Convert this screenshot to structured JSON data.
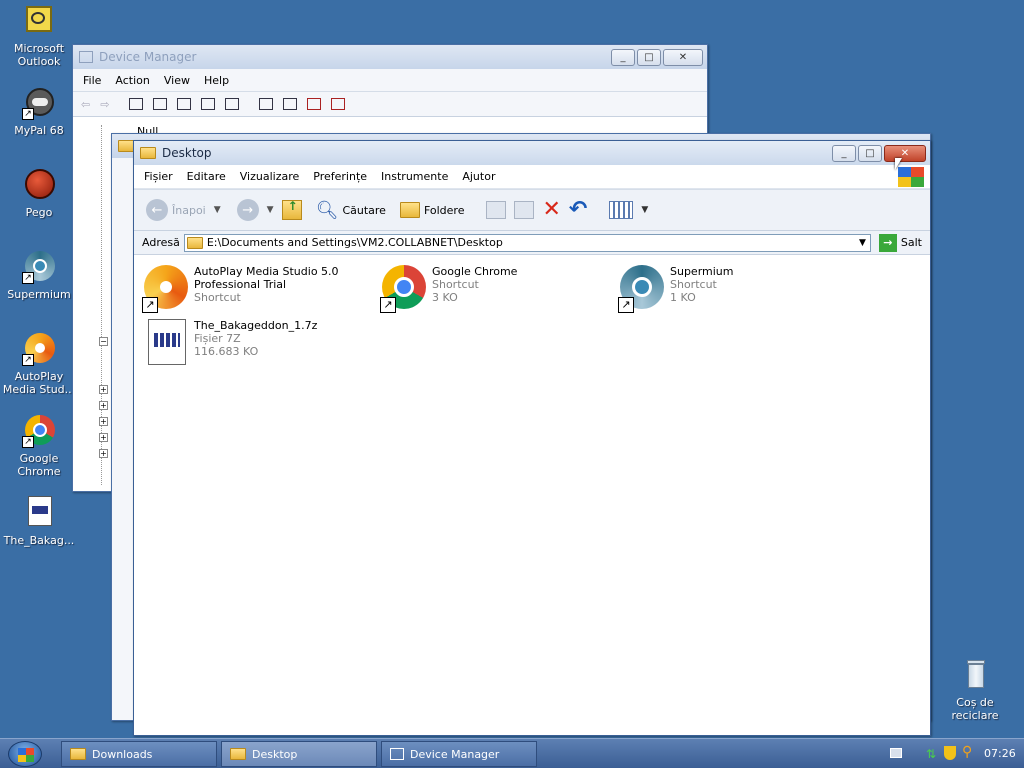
{
  "desktop_icons": [
    {
      "label": "Microsoft Outlook",
      "icon": "outlook-icon"
    },
    {
      "label": "MyPal 68",
      "icon": "mypal-icon"
    },
    {
      "label": "Pego",
      "icon": "pego-icon"
    },
    {
      "label": "Supermium",
      "icon": "supermium-icon"
    },
    {
      "label": "AutoPlay Media Stud...",
      "icon": "autoplay-icon"
    },
    {
      "label": "Google Chrome",
      "icon": "chrome-icon"
    },
    {
      "label": "The_Bakag...",
      "icon": "7z-file-icon"
    },
    {
      "label": "Coș de reciclare",
      "icon": "recycle-bin-icon"
    }
  ],
  "device_manager": {
    "title": "Device Manager",
    "menu": [
      "File",
      "Action",
      "View",
      "Help"
    ],
    "tree_first": "Null"
  },
  "explorer": {
    "title": "Desktop",
    "menu": [
      "Fișier",
      "Editare",
      "Vizualizare",
      "Preferințe",
      "Instrumente",
      "Ajutor"
    ],
    "toolbar": {
      "back": "Înapoi",
      "search": "Căutare",
      "folders": "Foldere"
    },
    "address_label": "Adresă",
    "address_value": "E:\\Documents and Settings\\VM2.COLLABNET\\Desktop",
    "go_label": "Salt",
    "files": [
      {
        "name": "AutoPlay Media Studio 5.0 Professional Trial",
        "type": "Shortcut",
        "size": ""
      },
      {
        "name": "Google Chrome",
        "type": "Shortcut",
        "size": "3 KO"
      },
      {
        "name": "Supermium",
        "type": "Shortcut",
        "size": "1 KO"
      },
      {
        "name": "The_Bakageddon_1.7z",
        "type": "Fișier 7Z",
        "size": "116.683 KO"
      }
    ]
  },
  "taskbar": {
    "buttons": [
      "Downloads",
      "Desktop",
      "Device Manager"
    ],
    "clock": "07:26"
  },
  "colors": {
    "desktop": "#3a6ea5",
    "taskbar": "#4b6ea5"
  }
}
